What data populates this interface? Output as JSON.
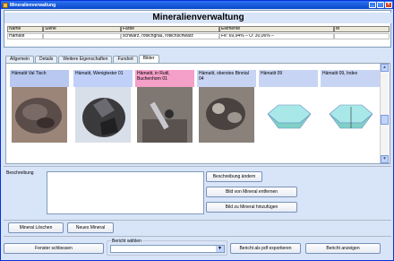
{
  "window": {
    "title": "Mineralienverwaltung"
  },
  "header": {
    "title": "Mineralienverwaltung"
  },
  "grid": {
    "columns": [
      "Name",
      "Siehe",
      "Farbe",
      "Elemente",
      "M"
    ],
    "row": [
      "Hämatit",
      "",
      "schwarz, rötlichgrau, rötlichschwarz",
      "Fe: 69,94% – O: 30,06% –",
      ""
    ]
  },
  "tabs": [
    "Allgemein",
    "Details",
    "Weitere Eigenschaften",
    "Fundort",
    "Bilder"
  ],
  "gallery": [
    {
      "caption": "Hämatit Val Tisch",
      "color": "#b8c8f0"
    },
    {
      "caption": "Hämatit, Wenigtexter 01",
      "color": "#c0d0f8"
    },
    {
      "caption": "Hämatit, in Rutil, Buchenhorn 01",
      "color": "#f4a0c8"
    },
    {
      "caption": "Hämatit, oberstes Binntal 04",
      "color": "#c8d4f4"
    },
    {
      "caption": "Hämatit 09",
      "color": "#c8d4f4"
    },
    {
      "caption": "Hämatit 09, Index",
      "color": "#c8d4f4"
    }
  ],
  "description": {
    "label": "Beschreibung",
    "value": ""
  },
  "buttons": {
    "change_description": "Beschreibung ändern",
    "remove_image": "Bild von Mineral entfernen",
    "add_image": "Bild zu Mineral hinzufügen",
    "delete_mineral": "Mineral Löschen",
    "new_mineral": "Neues Mineral",
    "close_window": "Fenster schliessen",
    "export_pdf": "Bericht als pdf exportieren",
    "show_report": "Bericht anzeigen"
  },
  "report": {
    "legend": "Bericht wählen",
    "selected": ""
  }
}
